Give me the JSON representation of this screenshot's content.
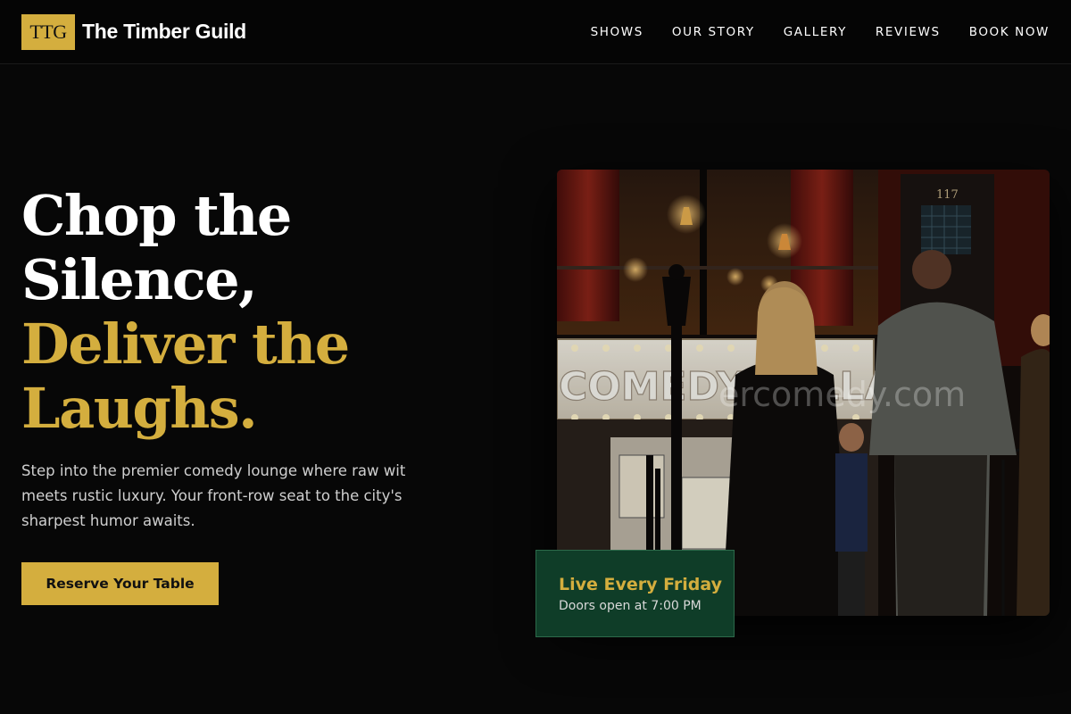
{
  "brand": {
    "logo_text": "TTG",
    "name": "The Timber Guild"
  },
  "nav": {
    "items": [
      {
        "label": "SHOWS"
      },
      {
        "label": "OUR STORY"
      },
      {
        "label": "GALLERY"
      },
      {
        "label": "REVIEWS"
      },
      {
        "label": "BOOK NOW"
      }
    ]
  },
  "hero": {
    "title_line1": "Chop the",
    "title_line2": "Silence,",
    "title_line3": "Deliver the",
    "title_line4": "Laughs.",
    "subtitle": "Step into the premier comedy lounge where raw wit meets rustic luxury. Your front-row seat to the city's sharpest humor awaits.",
    "cta_label": "Reserve Your Table"
  },
  "photo": {
    "marquee_text": "COMEDY CELLAR",
    "watermark": "ercomedy.com",
    "door_number": "117"
  },
  "badge": {
    "title": "Live Every Friday",
    "subtitle": "Doors open at 7:00 PM"
  },
  "colors": {
    "gold": "#d4ae3e",
    "background": "#070707",
    "badge_green": "#0f3d28"
  }
}
